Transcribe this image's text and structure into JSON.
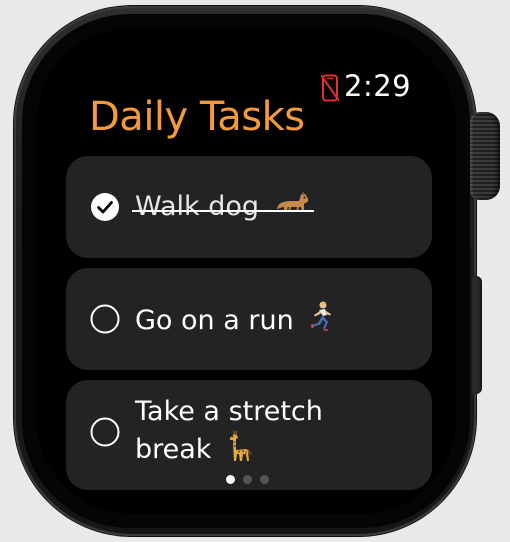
{
  "status": {
    "time": "2:29",
    "disconnect_icon": "iphone-disconnected-icon",
    "disconnect_color": "#e0312b"
  },
  "header": {
    "title": "Daily Tasks",
    "title_color": "#f29a3c"
  },
  "tasks": [
    {
      "label": "Walk dog",
      "emoji": "dog-emoji",
      "completed": true
    },
    {
      "label": "Go on a run",
      "emoji": "runner-emoji",
      "completed": false
    },
    {
      "label": "Take a stretch break",
      "emoji": "giraffe-emoji",
      "completed": false
    }
  ],
  "pager": {
    "page_count": 3,
    "current_page": 1
  },
  "colors": {
    "card_background": "#232325",
    "screen_background": "#000000",
    "text": "#ffffff"
  }
}
